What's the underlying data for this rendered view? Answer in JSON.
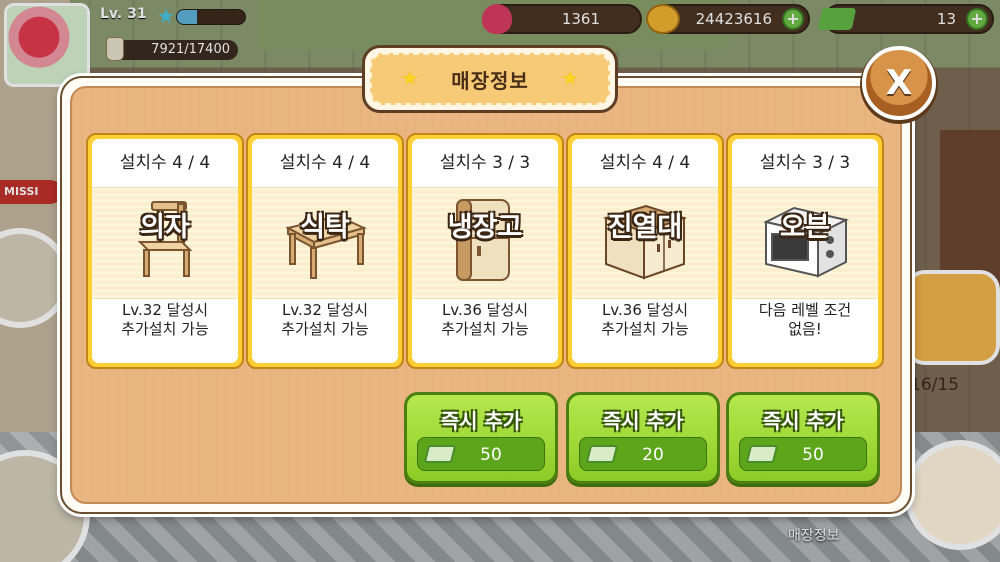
{
  "hud": {
    "level": "Lv. 31",
    "exp": "7921/17400",
    "exp_progress": 0.3,
    "hearts": "1361",
    "coins": "24423616",
    "cash": "13",
    "plus_symbol": "+"
  },
  "side": {
    "mission_label": "MISSI",
    "counter": "16/15",
    "store_info_label": "매장정보"
  },
  "modal": {
    "title": "매장정보",
    "close_label": "X",
    "cards": [
      {
        "count": "설치수 4 / 4",
        "name": "의자",
        "desc_line1": "Lv.32 달성시",
        "desc_line2": "추가설치 가능",
        "icon": "chair-icon"
      },
      {
        "count": "설치수 4 / 4",
        "name": "식탁",
        "desc_line1": "Lv.32 달성시",
        "desc_line2": "추가설치 가능",
        "icon": "table-icon"
      },
      {
        "count": "설치수 3 / 3",
        "name": "냉장고",
        "desc_line1": "Lv.36 달성시",
        "desc_line2": "추가설치 가능",
        "icon": "fridge-icon"
      },
      {
        "count": "설치수 4 / 4",
        "name": "진열대",
        "desc_line1": "Lv.36 달성시",
        "desc_line2": "추가설치 가능",
        "icon": "display-stand-icon"
      },
      {
        "count": "설치수 3 / 3",
        "name": "오븐",
        "desc_line1": "다음 레벨 조건",
        "desc_line2": "없음!",
        "icon": "oven-icon"
      }
    ],
    "buy_buttons": [
      {
        "label": "즉시 추가",
        "cost": "50"
      },
      {
        "label": "즉시 추가",
        "cost": "20"
      },
      {
        "label": "즉시 추가",
        "cost": "50"
      }
    ]
  },
  "colors": {
    "card_frame": "#ffcf36",
    "panel_wood": "#e9b580",
    "buy_green": "#8ccc26",
    "title_plate": "#f7ca77"
  }
}
